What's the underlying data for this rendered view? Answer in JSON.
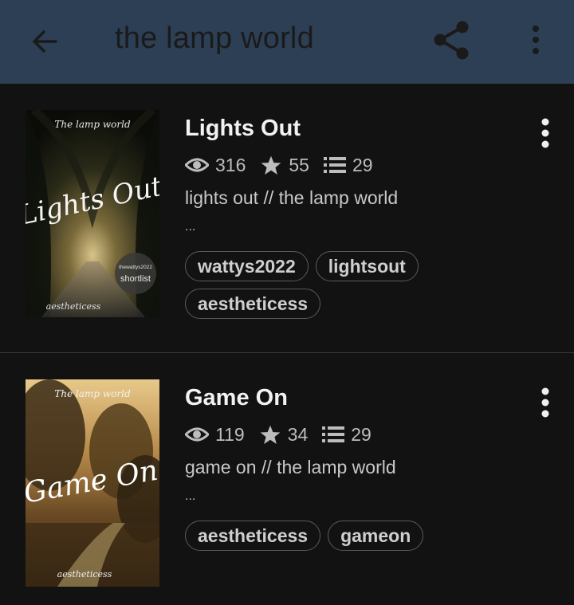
{
  "header": {
    "title": "the lamp world",
    "back_icon": "arrow-left-icon",
    "share_icon": "share-icon",
    "more_icon": "more-vertical-icon"
  },
  "stories": [
    {
      "title": "Lights Out",
      "views": "316",
      "votes": "55",
      "parts": "29",
      "description": "lights out // the lamp world",
      "ellipsis": "...",
      "tags": [
        "wattys2022",
        "lightsout",
        "aestheticess"
      ],
      "cover": {
        "top_text": "The lamp world",
        "script_title": "Lights Out",
        "badge_line1": "thewattys2022",
        "badge_line2": "shortlist",
        "author": "aestheticess"
      }
    },
    {
      "title": "Game On",
      "views": "119",
      "votes": "34",
      "parts": "29",
      "description": "game on // the lamp world",
      "ellipsis": "...",
      "tags": [
        "aestheticess",
        "gameon"
      ],
      "cover": {
        "top_text": "The lamp world",
        "script_title": "Game On",
        "author": "aestheticess"
      }
    }
  ]
}
